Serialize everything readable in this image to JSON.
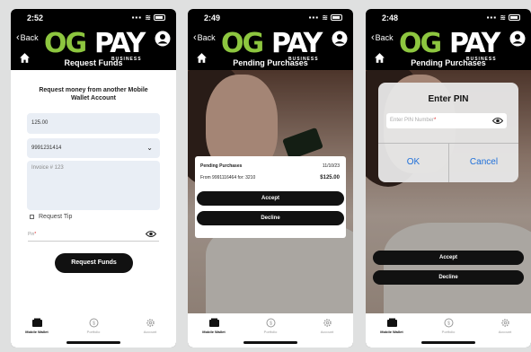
{
  "brand": {
    "og": "OG",
    "pay": "PAY",
    "business": "BUSINESS",
    "green": "#8dc63f"
  },
  "common": {
    "back_label": "Back"
  },
  "tabs": [
    {
      "label": "Mobile Wallet",
      "icon": "wallet-icon"
    },
    {
      "label": "Portfolio",
      "icon": "coin-icon"
    },
    {
      "label": "Account",
      "icon": "gear-icon"
    }
  ],
  "screens": [
    {
      "time": "2:52",
      "title": "Request Funds",
      "form": {
        "heading": "Request money from another Mobile Wallet Account",
        "amount": "125.00",
        "phone": "9991231414",
        "invoice": "Invoice # 123",
        "request_tip": "Request Tip",
        "pin_placeholder": "Pin",
        "pin_required": "*",
        "submit": "Request Funds"
      }
    },
    {
      "time": "2:49",
      "title": "Pending Purchases",
      "card": {
        "title": "Pending Purchases",
        "date": "11/10/23",
        "from": "From 9991116464 for: 3210",
        "amount": "$125.00",
        "accept": "Accept",
        "decline": "Decline"
      }
    },
    {
      "time": "2:48",
      "title": "Pending Purchases",
      "pin_dialog": {
        "title": "Enter PIN",
        "placeholder": "Enter PIN Number",
        "required": "*",
        "ok": "OK",
        "cancel": "Cancel"
      },
      "accept": "Accept",
      "decline": "Decline"
    }
  ]
}
